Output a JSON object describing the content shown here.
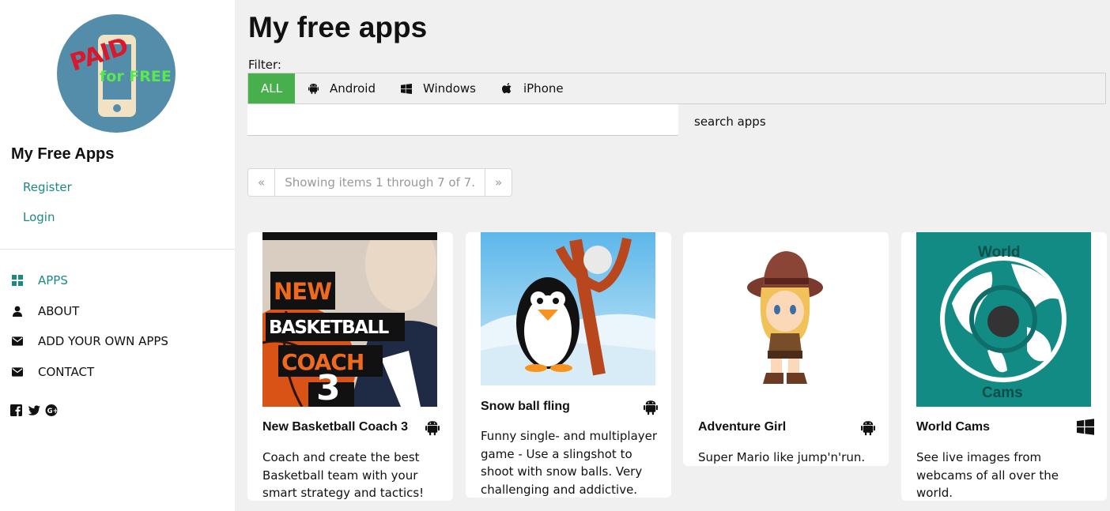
{
  "sidebar": {
    "logo": {
      "line1": "PAID",
      "line2": "for FREE"
    },
    "site_title": "My Free Apps",
    "auth_links": [
      "Register",
      "Login"
    ],
    "nav": [
      {
        "label": "APPS",
        "icon": "grid-icon",
        "active": true
      },
      {
        "label": "ABOUT",
        "icon": "user-icon",
        "active": false
      },
      {
        "label": "ADD YOUR OWN APPS",
        "icon": "envelope-icon",
        "active": false
      },
      {
        "label": "CONTACT",
        "icon": "envelope-icon",
        "active": false
      }
    ],
    "social": [
      "facebook-icon",
      "twitter-icon",
      "google-plus-icon"
    ]
  },
  "main": {
    "title": "My free apps",
    "filter_label": "Filter:",
    "filters": [
      {
        "label": "ALL",
        "active": true
      },
      {
        "label": "Android",
        "icon": "android-icon"
      },
      {
        "label": "Windows",
        "icon": "windows-icon"
      },
      {
        "label": "iPhone",
        "icon": "apple-icon"
      }
    ],
    "search": {
      "value": "",
      "placeholder": "",
      "button": "search apps"
    },
    "pager": {
      "prev": "«",
      "status": "Showing items 1 through 7 of 7.",
      "next": "»"
    },
    "cards": [
      {
        "title": "New Basketball Coach 3",
        "platform": "android-icon",
        "description": "Coach and create the best Basketball team with your smart strategy and tactics!",
        "thumb_lines": [
          "NEW",
          "BASKETBALL",
          "COACH",
          "3"
        ]
      },
      {
        "title": "Snow ball fling",
        "platform": "android-icon",
        "description": "Funny single- and multiplayer game - Use a slingshot to shoot with snow balls. Very challenging and addictive."
      },
      {
        "title": "Adventure Girl",
        "platform": "android-icon",
        "description": "Super Mario like jump'n'run."
      },
      {
        "title": "World Cams",
        "platform": "windows-icon",
        "description": "See live images from webcams of all over the world.",
        "thumb_lines": [
          "World",
          "Cams"
        ]
      }
    ]
  },
  "colors": {
    "accent": "#47af4c",
    "link": "#1c8a83",
    "logo_bg": "#548daa",
    "world_bg": "#138b85"
  }
}
